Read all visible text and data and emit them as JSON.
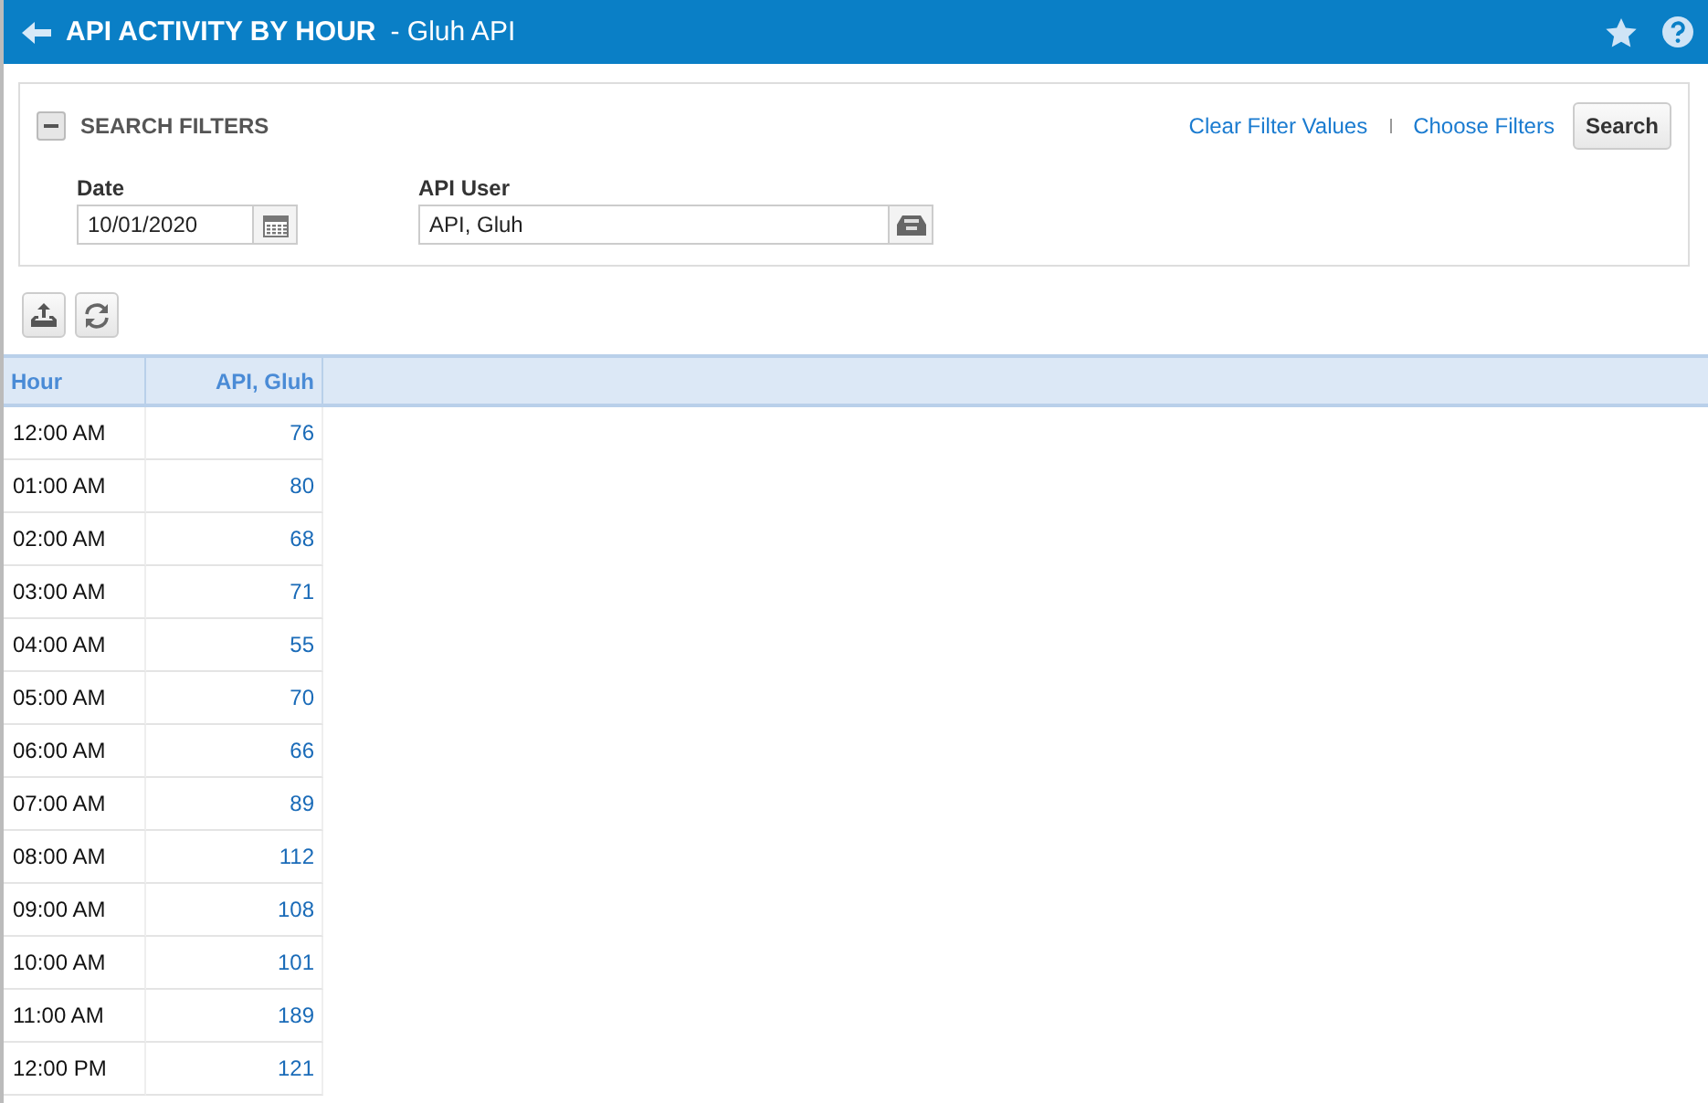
{
  "header": {
    "title": "API ACTIVITY BY HOUR",
    "subtitle": "- Gluh API"
  },
  "filters": {
    "title": "SEARCH FILTERS",
    "expanded": true,
    "links": [
      "Clear Filter Values",
      "Choose Filters"
    ],
    "search_button": "Search",
    "fields": [
      {
        "label": "Date",
        "value": "10/01/2020",
        "kind": "date"
      },
      {
        "label": "API User",
        "value": "API, Gluh",
        "kind": "lookup"
      }
    ]
  },
  "table": {
    "columns": [
      "Hour",
      "API, Gluh"
    ],
    "rows": [
      [
        "12:00 AM",
        "76"
      ],
      [
        "01:00 AM",
        "80"
      ],
      [
        "02:00 AM",
        "68"
      ],
      [
        "03:00 AM",
        "71"
      ],
      [
        "04:00 AM",
        "55"
      ],
      [
        "05:00 AM",
        "70"
      ],
      [
        "06:00 AM",
        "66"
      ],
      [
        "07:00 AM",
        "89"
      ],
      [
        "08:00 AM",
        "112"
      ],
      [
        "09:00 AM",
        "108"
      ],
      [
        "10:00 AM",
        "101"
      ],
      [
        "11:00 AM",
        "189"
      ],
      [
        "12:00 PM",
        "121"
      ]
    ]
  }
}
